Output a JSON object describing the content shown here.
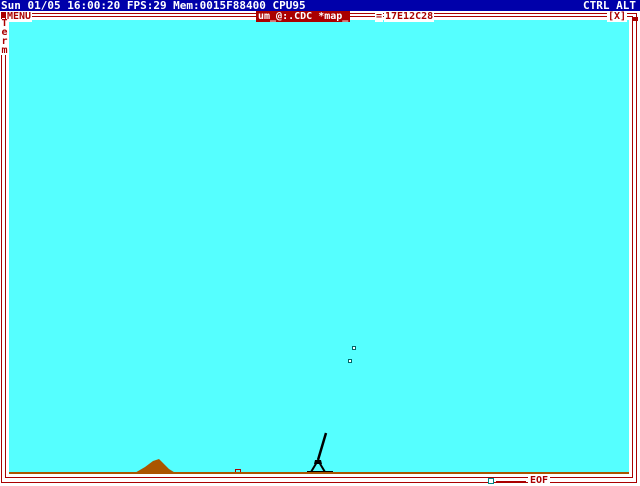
{
  "status_bar": {
    "left_text": "Sun 01/05 16:00:20 FPS:29 Mem:0015F88400 CPU95",
    "right_text": "CTRL ALT"
  },
  "window": {
    "menu_label": "MENU",
    "file_title": "um_@:.CDC *map_",
    "file_title_dash": "=",
    "task_id": "17E12C28",
    "close_box": "[X]",
    "side_label": "Term",
    "eof_label": "EOF"
  },
  "icons": {
    "menu": "menu-square-icon",
    "close": "close-icon",
    "corner": "resize-corner-icon",
    "scroll_thumb": "scroll-thumb-icon",
    "hill": "hill-icon",
    "cannon": "cannon-icon",
    "target": "target-marker-icon",
    "projectile": "projectile-icon"
  },
  "colors": {
    "status_bg": "#0000aa",
    "frame": "#aa0000",
    "sky": "#55ffff",
    "ground": "#aa5500",
    "cannon": "#000000"
  }
}
